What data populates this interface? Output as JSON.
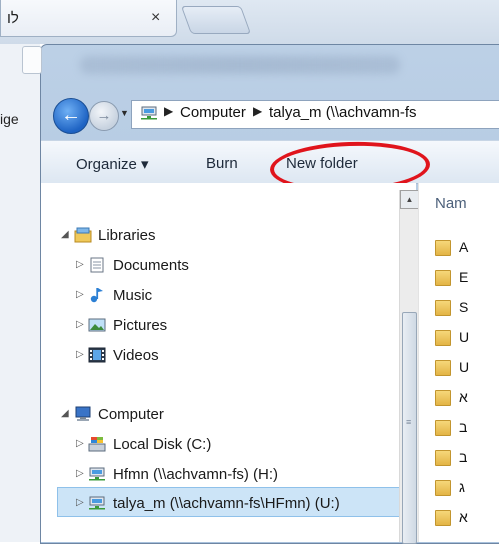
{
  "browser": {
    "tab_title": "לו",
    "tab_close": "×",
    "side_text": "ige"
  },
  "nav": {
    "back_glyph": "←",
    "forward_glyph": "→",
    "history_glyph": "▼"
  },
  "address": {
    "separator": "▶",
    "crumbs": [
      "Computer",
      "talya_m (\\\\achvamn-fs"
    ]
  },
  "toolbar": {
    "organize_label": "Organize ▾",
    "burn_label": "Burn",
    "new_folder_label": "New folder"
  },
  "tree": {
    "libraries": "Libraries",
    "documents": "Documents",
    "music": "Music",
    "pictures": "Pictures",
    "videos": "Videos",
    "computer": "Computer",
    "local_disk": "Local Disk (C:)",
    "hfmn": "Hfmn (\\\\achvamn-fs) (H:)",
    "talya": "talya_m (\\\\achvamn-fs\\HFmn) (U:)",
    "expanded_arrow": "◢",
    "collapsed_arrow": "▷"
  },
  "scrollbar": {
    "up_glyph": "▲",
    "grip_glyph": "≡"
  },
  "content": {
    "column_name": "Nam",
    "files": [
      "A",
      "E",
      "S",
      "U",
      "U",
      "א",
      "ב",
      "ב",
      "ג",
      "א"
    ]
  },
  "colors": {
    "highlight_oval": "#e0141c",
    "selection": "#cce4f7",
    "accent": "#1e63c3"
  }
}
